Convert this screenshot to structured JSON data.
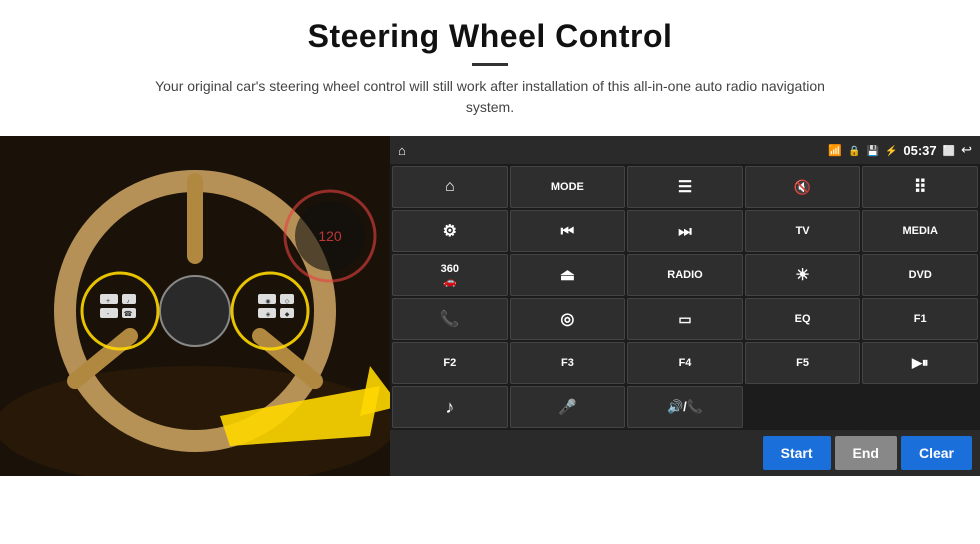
{
  "header": {
    "title": "Steering Wheel Control",
    "subtitle": "Your original car's steering wheel control will still work after installation of this all-in-one auto radio navigation system."
  },
  "statusBar": {
    "time": "05:37",
    "icons": [
      "wifi",
      "lock",
      "sd",
      "bluetooth"
    ]
  },
  "buttons": [
    {
      "id": "home",
      "type": "icon",
      "icon": "home",
      "label": ""
    },
    {
      "id": "mode",
      "type": "text",
      "label": "MODE"
    },
    {
      "id": "menu",
      "type": "icon",
      "icon": "menu",
      "label": ""
    },
    {
      "id": "mute",
      "type": "icon",
      "icon": "mute",
      "label": ""
    },
    {
      "id": "apps",
      "type": "icon",
      "icon": "apps",
      "label": ""
    },
    {
      "id": "settings",
      "type": "icon",
      "icon": "settings",
      "label": ""
    },
    {
      "id": "prev",
      "type": "icon",
      "icon": "prev",
      "label": ""
    },
    {
      "id": "next",
      "type": "icon",
      "icon": "next",
      "label": ""
    },
    {
      "id": "tv",
      "type": "text",
      "label": "TV"
    },
    {
      "id": "media",
      "type": "text",
      "label": "MEDIA"
    },
    {
      "id": "car360",
      "type": "icon",
      "icon": "car360",
      "label": ""
    },
    {
      "id": "eject",
      "type": "icon",
      "icon": "eject",
      "label": ""
    },
    {
      "id": "radio",
      "type": "text",
      "label": "RADIO"
    },
    {
      "id": "brightness",
      "type": "icon",
      "icon": "brightness",
      "label": ""
    },
    {
      "id": "dvd",
      "type": "text",
      "label": "DVD"
    },
    {
      "id": "phone",
      "type": "icon",
      "icon": "phone",
      "label": ""
    },
    {
      "id": "globe",
      "type": "icon",
      "icon": "globe",
      "label": ""
    },
    {
      "id": "window",
      "type": "icon",
      "icon": "window",
      "label": ""
    },
    {
      "id": "eq",
      "type": "text",
      "label": "EQ"
    },
    {
      "id": "f1",
      "type": "text",
      "label": "F1"
    },
    {
      "id": "f2",
      "type": "text",
      "label": "F2"
    },
    {
      "id": "f3",
      "type": "text",
      "label": "F3"
    },
    {
      "id": "f4",
      "type": "text",
      "label": "F4"
    },
    {
      "id": "f5",
      "type": "text",
      "label": "F5"
    },
    {
      "id": "playpause",
      "type": "icon",
      "icon": "playpause",
      "label": ""
    },
    {
      "id": "music",
      "type": "icon",
      "icon": "music",
      "label": ""
    },
    {
      "id": "mic",
      "type": "icon",
      "icon": "mic",
      "label": ""
    },
    {
      "id": "vol",
      "type": "icon",
      "icon": "vol",
      "label": ""
    },
    {
      "id": "empty1",
      "type": "empty",
      "label": ""
    },
    {
      "id": "empty2",
      "type": "empty",
      "label": ""
    }
  ],
  "bottomBar": {
    "startLabel": "Start",
    "endLabel": "End",
    "clearLabel": "Clear"
  }
}
